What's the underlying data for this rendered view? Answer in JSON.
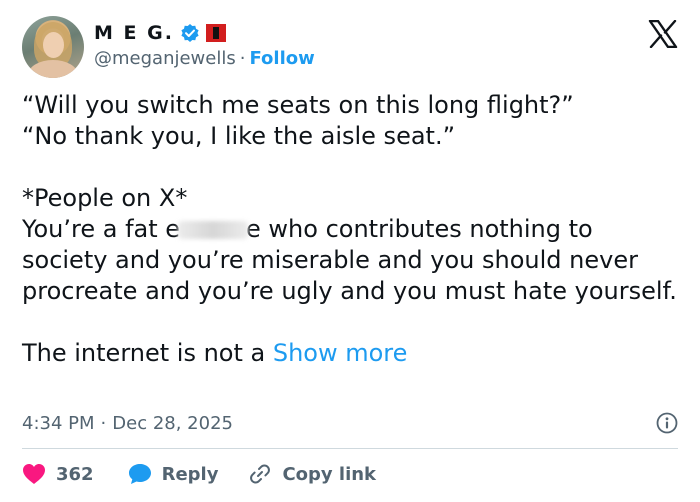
{
  "author": {
    "display_name": "M E G.",
    "handle": "@meganjewells",
    "separator": "·",
    "follow_label": "Follow",
    "verified_color": "#1d9bf0"
  },
  "tweet": {
    "lines": [
      "“Will you switch me seats on this long flight?”",
      "“No thank you, I like the aisle seat.”",
      "",
      "*People on X*"
    ],
    "insult_prefix": "You’re a fat e",
    "insult_suffix": "e who contributes nothing to society and you’re miserable and you should never procreate and you’re ugly and you must hate yourself.",
    "closing_text": "The internet is not a ",
    "show_more_label": "Show more"
  },
  "meta": {
    "time": "4:34 PM",
    "separator": "·",
    "date": "Dec 28, 2025"
  },
  "actions": {
    "like_count": "362",
    "reply_label": "Reply",
    "copy_link_label": "Copy link"
  },
  "colors": {
    "accent": "#1d9bf0",
    "like": "#f91880",
    "secondary_text": "#536471"
  }
}
